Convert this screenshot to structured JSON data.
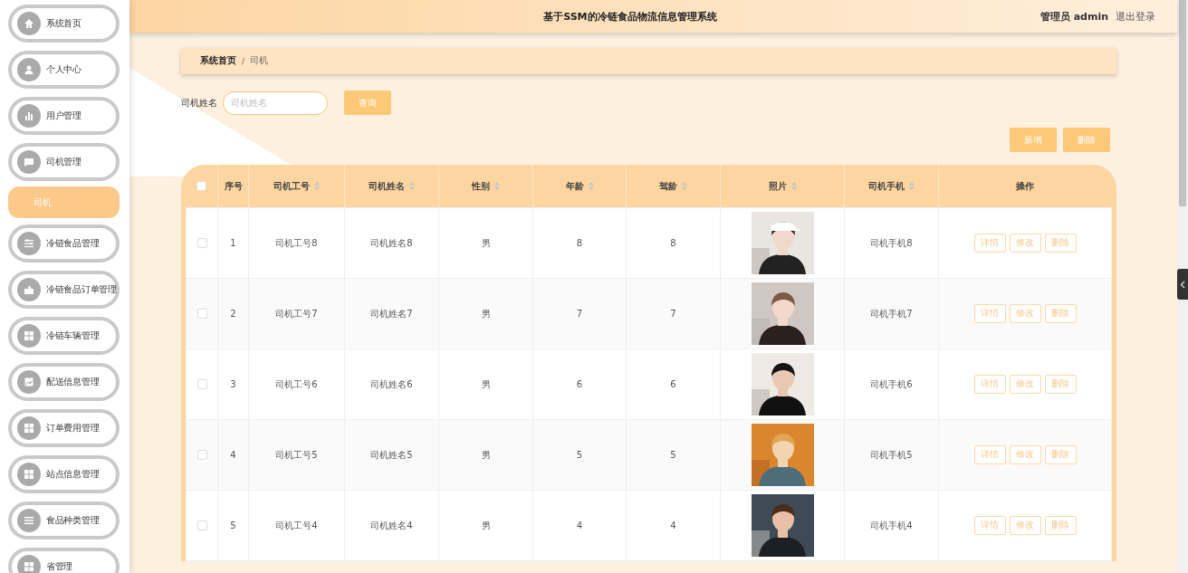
{
  "sidebar": {
    "items": [
      {
        "kind": "menu",
        "label": "系统首页",
        "selected": false
      },
      {
        "kind": "menu",
        "label": "个人中心",
        "selected": false
      },
      {
        "kind": "menu",
        "label": "用户管理",
        "selected": false
      },
      {
        "kind": "menu",
        "label": "司机管理",
        "selected": false
      },
      {
        "kind": "submenu",
        "label": "司机",
        "selected": true
      },
      {
        "kind": "menu",
        "label": "冷链食品管理",
        "selected": false
      },
      {
        "kind": "menu",
        "label": "冷链食品订单管理",
        "selected": false
      },
      {
        "kind": "menu",
        "label": "冷链车辆管理",
        "selected": false
      },
      {
        "kind": "menu",
        "label": "配送信息管理",
        "selected": false
      },
      {
        "kind": "menu",
        "label": "订单费用管理",
        "selected": false
      },
      {
        "kind": "menu",
        "label": "站点信息管理",
        "selected": false
      },
      {
        "kind": "menu",
        "label": "食品种类管理",
        "selected": false
      },
      {
        "kind": "menu",
        "label": "省管理",
        "selected": false
      }
    ]
  },
  "header": {
    "title": "基于SSM的冷链食品物流信息管理系统",
    "user": "管理员 admin",
    "logout": "退出登录"
  },
  "breadcrumb": [
    "系统首页",
    "/",
    "司机"
  ],
  "search": {
    "label": "司机姓名",
    "placeholder": "司机姓名",
    "button": "查询"
  },
  "actions": [
    "新增",
    "删除"
  ],
  "table": {
    "select_all": {
      "checked": false
    },
    "columns": [
      {
        "label": "序号",
        "sortable": false
      },
      {
        "label": "司机工号",
        "sortable": true
      },
      {
        "label": "司机姓名",
        "sortable": true
      },
      {
        "label": "性别",
        "sortable": true
      },
      {
        "label": "年龄",
        "sortable": true
      },
      {
        "label": "驾龄",
        "sortable": true
      },
      {
        "label": "照片",
        "sortable": true
      },
      {
        "label": "司机手机",
        "sortable": true
      },
      {
        "label": "操作",
        "sortable": false
      }
    ],
    "rows": [
      {
        "checked": false,
        "index": "1",
        "id": "司机工号8",
        "name": "司机姓名8",
        "gender": "男",
        "age": "8",
        "years": "8",
        "phone": "司机手机8",
        "ops": [
          "详情",
          "修改",
          "删除"
        ]
      },
      {
        "checked": false,
        "index": "2",
        "id": "司机工号7",
        "name": "司机姓名7",
        "gender": "男",
        "age": "7",
        "years": "7",
        "phone": "司机手机7",
        "ops": [
          "详情",
          "修改",
          "删除"
        ]
      },
      {
        "checked": false,
        "index": "3",
        "id": "司机工号6",
        "name": "司机姓名6",
        "gender": "男",
        "age": "6",
        "years": "6",
        "phone": "司机手机6",
        "ops": [
          "详情",
          "修改",
          "删除"
        ]
      },
      {
        "checked": false,
        "index": "4",
        "id": "司机工号5",
        "name": "司机姓名5",
        "gender": "男",
        "age": "5",
        "years": "5",
        "phone": "司机手机5",
        "ops": [
          "详情",
          "修改",
          "删除"
        ]
      },
      {
        "checked": false,
        "index": "5",
        "id": "司机工号4",
        "name": "司机姓名4",
        "gender": "男",
        "age": "4",
        "years": "4",
        "phone": "司机手机4",
        "ops": [
          "详情",
          "修改",
          "删除"
        ]
      }
    ]
  }
}
